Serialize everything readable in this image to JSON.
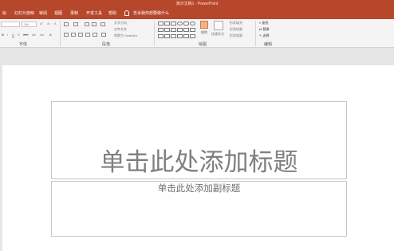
{
  "window": {
    "title": "演示文稿1 - PowerPoint"
  },
  "tabs": [
    "文件",
    "开始",
    "插入",
    "设计",
    "切换",
    "动画",
    "幻灯片放映",
    "审阅",
    "视图",
    "开发工具",
    "帮助"
  ],
  "tabs_visible": [
    "始",
    "幻灯片放映",
    "审阅",
    "视图",
    "录制",
    "开发工具",
    "帮助"
  ],
  "tell_me": "告诉我你想要做什么",
  "ribbon": {
    "groups": {
      "font": "字体",
      "paragraph": "段落",
      "drawing": "绘图",
      "editing": "编辑"
    },
    "font_size": "18+",
    "text_direction": "文字方向",
    "align_text": "对齐文本",
    "smartart": "转换为 SmartArt",
    "arrange": "排列",
    "quick_styles": "快速样式",
    "shape_fill": "形状填充",
    "shape_outline": "形状轮廓",
    "shape_effects": "形状效果",
    "find": "查找",
    "replace": "替换",
    "select": "选择"
  },
  "slide": {
    "title_placeholder": "单击此处添加标题",
    "subtitle_placeholder": "单击此处添加副标题"
  }
}
